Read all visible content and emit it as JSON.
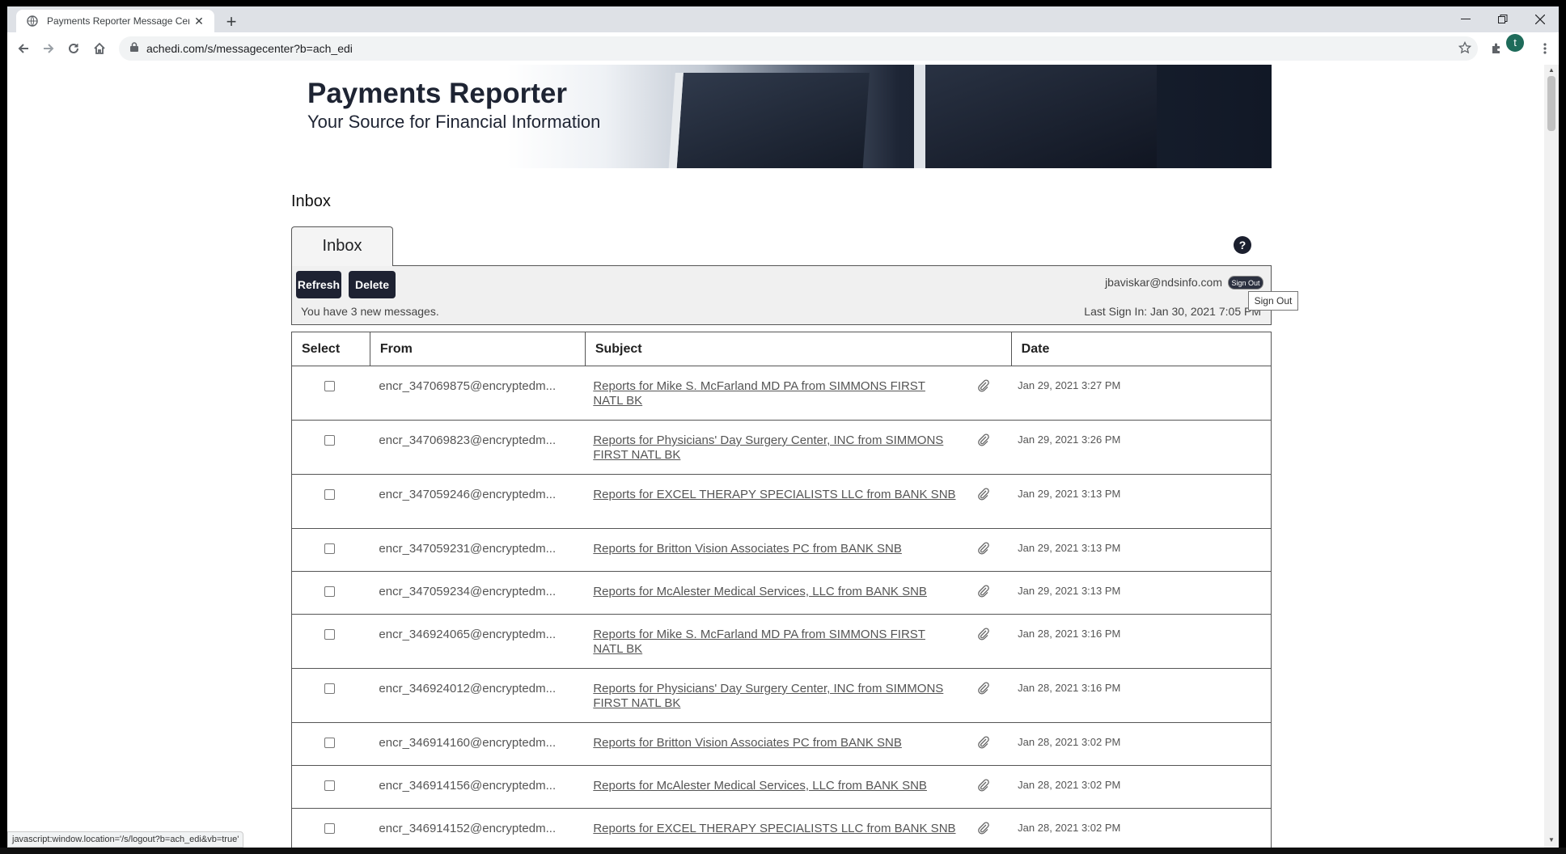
{
  "browser": {
    "tab_title": "Payments Reporter Message Cen",
    "url": "achedi.com/s/messagecenter?b=ach_edi",
    "profile_initial": "t",
    "status_url": "javascript:window.location='/s/logout?b=ach_edi&vb=true'"
  },
  "banner": {
    "title": "Payments Reporter",
    "subtitle": "Your Source for Financial Information"
  },
  "page": {
    "heading": "Inbox",
    "tab_label": "Inbox",
    "help_symbol": "?"
  },
  "actions": {
    "refresh_label": "Refresh",
    "delete_label": "Delete",
    "new_messages": "You have 3 new messages.",
    "user_email": "jbaviskar@ndsinfo.com",
    "signout_label": "Sign Out",
    "last_sign_in": "Last Sign In: Jan 30, 2021 7:05 PM",
    "tooltip": "Sign Out"
  },
  "table": {
    "headers": {
      "select": "Select",
      "from": "From",
      "subject": "Subject",
      "date": "Date"
    },
    "rows": [
      {
        "from": "encr_347069875@encryptedm...",
        "subject": "Reports for Mike S. McFarland MD PA from SIMMONS FIRST NATL BK",
        "date": "Jan 29, 2021 3:27 PM"
      },
      {
        "from": "encr_347069823@encryptedm...",
        "subject": "Reports for Physicians' Day Surgery Center, INC from SIMMONS FIRST NATL BK",
        "date": "Jan 29, 2021 3:26 PM"
      },
      {
        "from": "encr_347059246@encryptedm...",
        "subject": "Reports for EXCEL THERAPY SPECIALISTS LLC from BANK SNB",
        "date": "Jan 29, 2021 3:13 PM"
      },
      {
        "from": "encr_347059231@encryptedm...",
        "subject": "Reports for Britton Vision Associates PC from BANK SNB",
        "date": "Jan 29, 2021 3:13 PM"
      },
      {
        "from": "encr_347059234@encryptedm...",
        "subject": "Reports for McAlester Medical Services, LLC from BANK SNB",
        "date": "Jan 29, 2021 3:13 PM"
      },
      {
        "from": "encr_346924065@encryptedm...",
        "subject": "Reports for Mike S. McFarland MD PA from SIMMONS FIRST NATL BK",
        "date": "Jan 28, 2021 3:16 PM"
      },
      {
        "from": "encr_346924012@encryptedm...",
        "subject": "Reports for Physicians' Day Surgery Center, INC from SIMMONS FIRST NATL BK",
        "date": "Jan 28, 2021 3:16 PM"
      },
      {
        "from": "encr_346914160@encryptedm...",
        "subject": "Reports for Britton Vision Associates PC from BANK SNB",
        "date": "Jan 28, 2021 3:02 PM"
      },
      {
        "from": "encr_346914156@encryptedm...",
        "subject": "Reports for McAlester Medical Services, LLC from BANK SNB",
        "date": "Jan 28, 2021 3:02 PM"
      },
      {
        "from": "encr_346914152@encryptedm...",
        "subject": "Reports for EXCEL THERAPY SPECIALISTS LLC from BANK SNB",
        "date": "Jan 28, 2021 3:02 PM"
      }
    ]
  },
  "icons": {
    "favicon": "globe-icon",
    "attachment": "paperclip-icon"
  }
}
